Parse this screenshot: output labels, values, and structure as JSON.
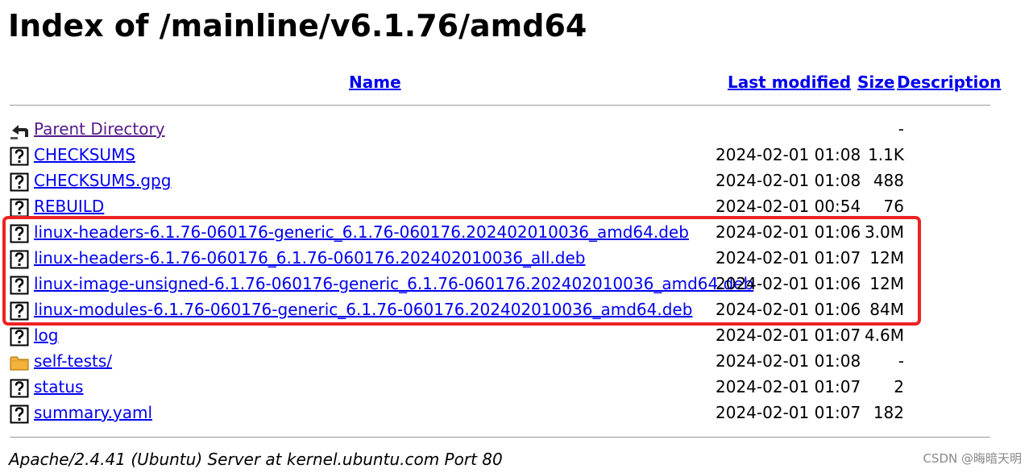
{
  "page": {
    "title": "Index of /mainline/v6.1.76/amd64"
  },
  "columns": {
    "name": "Name",
    "last_modified": "Last modified",
    "size": "Size",
    "description": "Description"
  },
  "rows": [
    {
      "icon": "back-icon",
      "name": "Parent Directory",
      "date": "",
      "size": "-"
    },
    {
      "icon": "unknown-file-icon",
      "name": "CHECKSUMS",
      "date": "2024-02-01 01:08",
      "size": "1.1K"
    },
    {
      "icon": "unknown-file-icon",
      "name": "CHECKSUMS.gpg",
      "date": "2024-02-01 01:08",
      "size": "488"
    },
    {
      "icon": "unknown-file-icon",
      "name": "REBUILD",
      "date": "2024-02-01 00:54",
      "size": "76"
    },
    {
      "icon": "unknown-file-icon",
      "name": "linux-headers-6.1.76-060176-generic_6.1.76-060176.202402010036_amd64.deb",
      "date": "2024-02-01 01:06",
      "size": "3.0M"
    },
    {
      "icon": "unknown-file-icon",
      "name": "linux-headers-6.1.76-060176_6.1.76-060176.202402010036_all.deb",
      "date": "2024-02-01 01:07",
      "size": "12M"
    },
    {
      "icon": "unknown-file-icon",
      "name": "linux-image-unsigned-6.1.76-060176-generic_6.1.76-060176.202402010036_amd64.deb",
      "date": "2024-02-01 01:06",
      "size": "12M"
    },
    {
      "icon": "unknown-file-icon",
      "name": "linux-modules-6.1.76-060176-generic_6.1.76-060176.202402010036_amd64.deb",
      "date": "2024-02-01 01:06",
      "size": "84M"
    },
    {
      "icon": "unknown-file-icon",
      "name": "log",
      "date": "2024-02-01 01:07",
      "size": "4.6M"
    },
    {
      "icon": "folder-icon",
      "name": "self-tests/",
      "date": "2024-02-01 01:08",
      "size": "-"
    },
    {
      "icon": "unknown-file-icon",
      "name": "status",
      "date": "2024-02-01 01:07",
      "size": "2"
    },
    {
      "icon": "unknown-file-icon",
      "name": "summary.yaml",
      "date": "2024-02-01 01:07",
      "size": "182"
    }
  ],
  "footer": "Apache/2.4.41 (Ubuntu) Server at kernel.ubuntu.com Port 80",
  "watermark": "CSDN @晦暗天明",
  "colors": {
    "link": "#0000ee",
    "visited_link": "#551a8b",
    "highlight_border": "#ee2222"
  }
}
